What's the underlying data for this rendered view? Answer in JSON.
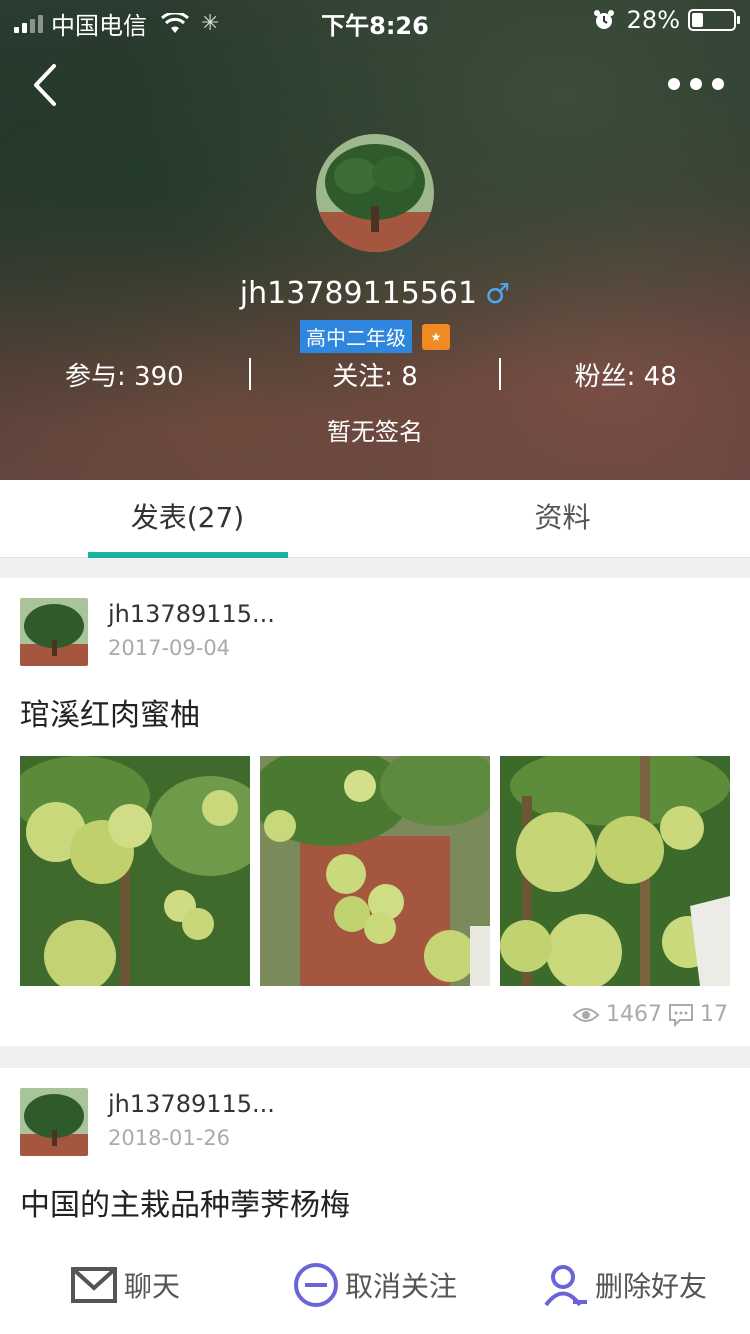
{
  "status_bar": {
    "carrier": "中国电信",
    "time": "下午8:26",
    "battery": "28%",
    "battery_level": 0.28
  },
  "profile": {
    "username": "jh13789115561",
    "gender_symbol": "♂",
    "grade_badge": "高中二年级",
    "stats": {
      "participate": "参与: 390",
      "following": "关注: 8",
      "fans": "粉丝: 48"
    },
    "signature": "暂无签名"
  },
  "tabs": [
    {
      "label": "发表(27)",
      "active": true
    },
    {
      "label": "资料",
      "active": false
    }
  ],
  "posts": [
    {
      "author": "jh13789115...",
      "date": "2017-09-04",
      "title": "琯溪红肉蜜柚",
      "views": "1467",
      "comments": "17"
    },
    {
      "author": "jh13789115...",
      "date": "2018-01-26",
      "title": "中国的主栽品种荸荠杨梅"
    }
  ],
  "actions": {
    "chat": "聊天",
    "unfollow": "取消关注",
    "delete_friend": "删除好友"
  },
  "colors": {
    "accent": "#1ab1a3",
    "grade_badge": "#2e86de",
    "action_icon": "#6b63d8"
  },
  "icons": [
    "back-icon",
    "more-icon",
    "eye-icon",
    "comment-icon",
    "mail-icon",
    "minus-circle-icon",
    "user-remove-icon"
  ]
}
